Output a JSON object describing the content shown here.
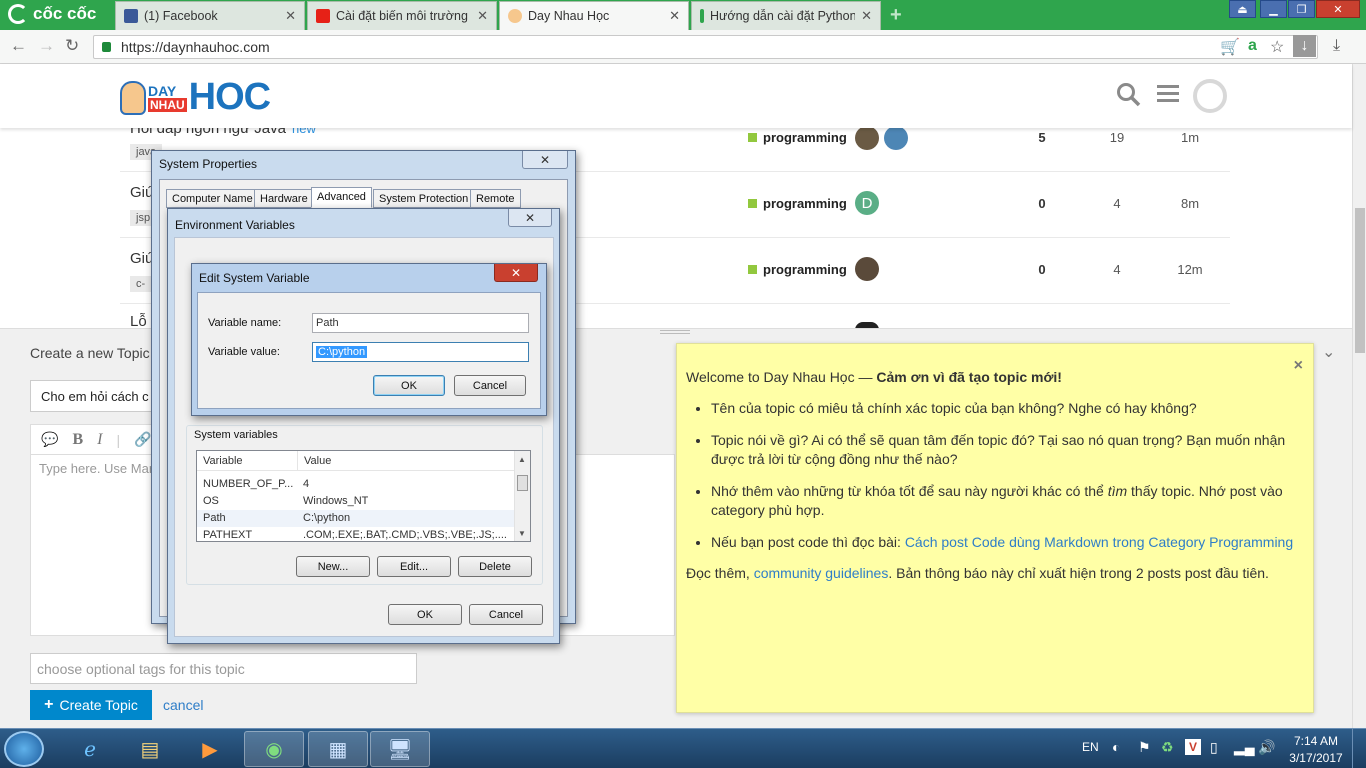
{
  "browser": {
    "brand": "cốc cốc",
    "tabs": [
      {
        "label": "(1) Facebook",
        "color": "#3b5998"
      },
      {
        "label": "Cài đặt biến môi trường tr",
        "color": "#e62117"
      },
      {
        "label": "Day Nhau Học",
        "color": "#f6c78d"
      },
      {
        "label": "Hướng dẫn cài đặt Python",
        "color": "#2fa54d"
      }
    ],
    "url": "https://daynhauhoc.com"
  },
  "site": {
    "logo": {
      "day": "DAY",
      "nhau": "NHAU",
      "hoc": "HOC"
    }
  },
  "topics": [
    {
      "title": "Hỏi đáp ngôn ngữ Java",
      "new_badge": "new",
      "tag": "java",
      "category": "programming",
      "replies": "5",
      "views": "19",
      "activity": "1m"
    },
    {
      "title": "Giú",
      "tag": "jsp",
      "category": "programming",
      "replies": "0",
      "views": "4",
      "activity": "8m"
    },
    {
      "title": "Giú",
      "tag": "c-",
      "category": "programming",
      "replies": "0",
      "views": "4",
      "activity": "12m"
    },
    {
      "title": "Lỗ"
    }
  ],
  "composer": {
    "heading": "Create a new Topic",
    "title_value": "Cho em hỏi cách c",
    "editor_placeholder": "Type here. Use Mar",
    "tags_placeholder": "choose optional tags for this topic",
    "create_label": "Create Topic",
    "cancel_label": "cancel"
  },
  "popup": {
    "intro_plain": "Welcome to Day Nhau Học — ",
    "intro_bold": "Cảm ơn vì đã tạo topic mới!",
    "bullets": [
      "Tên của topic có miêu tả chính xác topic của bạn không? Nghe có hay không?",
      "Topic nói về gì? Ai có thể sẽ quan tâm đến topic đó? Tại sao nó quan trọng? Bạn muốn nhận được trả lời từ cộng đồng như thế nào?"
    ],
    "bullet3_a": "Nhớ thêm vào những từ khóa tốt để sau này người khác có thể ",
    "bullet3_em": "tìm",
    "bullet3_b": " thấy topic. Nhớ post vào category phù hợp.",
    "bullet4_text": "Nếu bạn post code thì đọc bài: ",
    "bullet4_link": "Cách post Code dùng Markdown trong Category Programming",
    "footer_a": "Đọc thêm, ",
    "footer_link": "community guidelines",
    "footer_b": ". Bản thông báo này chỉ xuất hiện trong 2 posts post đầu tiên."
  },
  "sysprops": {
    "title": "System Properties",
    "tabs": [
      "Computer Name",
      "Hardware",
      "Advanced",
      "System Protection",
      "Remote"
    ]
  },
  "envvars": {
    "title": "Environment Variables",
    "system_vars_label": "System variables",
    "columns": [
      "Variable",
      "Value"
    ],
    "rows": [
      {
        "var": "NUMBER_OF_P...",
        "val": "4"
      },
      {
        "var": "OS",
        "val": "Windows_NT"
      },
      {
        "var": "Path",
        "val": "C:\\python"
      },
      {
        "var": "PATHEXT",
        "val": ".COM;.EXE;.BAT;.CMD;.VBS;.VBE;.JS;...."
      }
    ],
    "new_label": "New...",
    "edit_label": "Edit...",
    "delete_label": "Delete",
    "ok_label": "OK",
    "cancel_label": "Cancel"
  },
  "editvar": {
    "title": "Edit System Variable",
    "name_label": "Variable name:",
    "name_value": "Path",
    "value_label": "Variable value:",
    "value_value": "C:\\python",
    "ok_label": "OK",
    "cancel_label": "Cancel"
  },
  "taskbar": {
    "lang": "EN",
    "time": "7:14 AM",
    "date": "3/17/2017"
  }
}
